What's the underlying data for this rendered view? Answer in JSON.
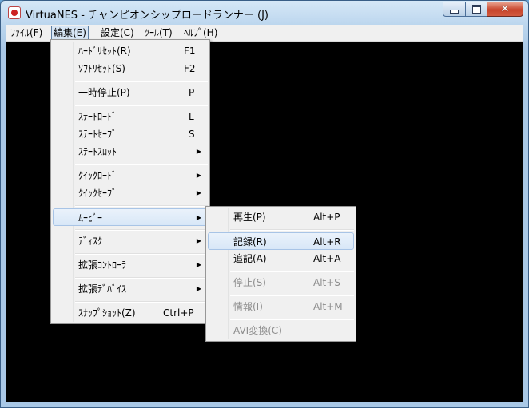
{
  "window": {
    "title": "VirtuaNES - チャンピオンシップロードランナー (J)"
  },
  "menubar": [
    {
      "label": "ﾌｧｲﾙ(F)"
    },
    {
      "label": "編集(E)"
    },
    {
      "label": "設定(C)"
    },
    {
      "label": "ﾂｰﾙ(T)"
    },
    {
      "label": "ﾍﾙﾌﾟ(H)"
    }
  ],
  "edit_menu": {
    "items": [
      {
        "label": "ﾊｰﾄﾞﾘｾｯﾄ(R)",
        "shortcut": "F1"
      },
      {
        "label": "ｿﾌﾄﾘｾｯﾄ(S)",
        "shortcut": "F2"
      },
      {
        "label": "一時停止(P)",
        "shortcut": "P"
      },
      {
        "label": "ｽﾃｰﾄﾛｰﾄﾞ",
        "shortcut": "L"
      },
      {
        "label": "ｽﾃｰﾄｾｰﾌﾞ",
        "shortcut": "S"
      },
      {
        "label": "ｽﾃｰﾄｽﾛｯﾄ",
        "shortcut": ""
      },
      {
        "label": "ｸｲｯｸﾛｰﾄﾞ",
        "shortcut": ""
      },
      {
        "label": "ｸｲｯｸｾｰﾌﾞ",
        "shortcut": ""
      },
      {
        "label": "ﾑｰﾋﾞｰ",
        "shortcut": ""
      },
      {
        "label": "ﾃﾞｨｽｸ",
        "shortcut": ""
      },
      {
        "label": "拡張ｺﾝﾄﾛｰﾗ",
        "shortcut": ""
      },
      {
        "label": "拡張ﾃﾞﾊﾞｲｽ",
        "shortcut": ""
      },
      {
        "label": "ｽﾅｯﾌﾟｼｮｯﾄ(Z)",
        "shortcut": "Ctrl+P"
      }
    ]
  },
  "movie_submenu": {
    "items": [
      {
        "label": "再生(P)",
        "shortcut": "Alt+P",
        "enabled": true
      },
      {
        "label": "記録(R)",
        "shortcut": "Alt+R",
        "enabled": true
      },
      {
        "label": "追記(A)",
        "shortcut": "Alt+A",
        "enabled": true
      },
      {
        "label": "停止(S)",
        "shortcut": "Alt+S",
        "enabled": false
      },
      {
        "label": "情報(I)",
        "shortcut": "Alt+M",
        "enabled": false
      },
      {
        "label": "AVI変換(C)",
        "shortcut": "",
        "enabled": false
      }
    ]
  },
  "icons": {
    "submenu_arrow": "▶",
    "close": "✕"
  }
}
